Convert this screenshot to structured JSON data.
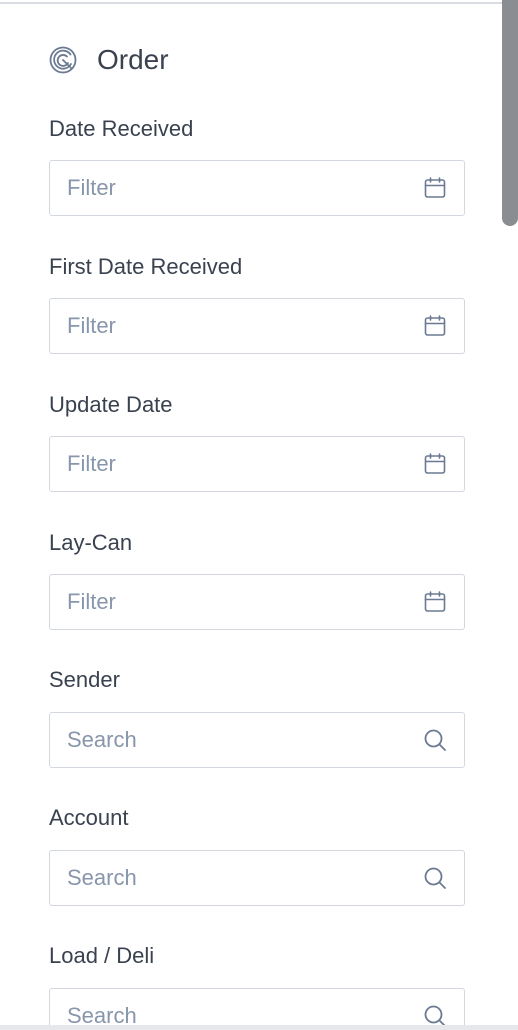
{
  "header": {
    "title": "Order",
    "logo_icon": "circular-logo-icon"
  },
  "fields": [
    {
      "label": "Date Received",
      "placeholder": "Filter",
      "icon": "calendar-icon"
    },
    {
      "label": "First Date Received",
      "placeholder": "Filter",
      "icon": "calendar-icon"
    },
    {
      "label": "Update Date",
      "placeholder": "Filter",
      "icon": "calendar-icon"
    },
    {
      "label": "Lay-Can",
      "placeholder": "Filter",
      "icon": "calendar-icon"
    },
    {
      "label": "Sender",
      "placeholder": "Search",
      "icon": "search-icon"
    },
    {
      "label": "Account",
      "placeholder": "Search",
      "icon": "search-icon"
    },
    {
      "label": "Load / Deli",
      "placeholder": "Search",
      "icon": "search-icon"
    }
  ],
  "colors": {
    "text": "#3a4250",
    "placeholder": "#8896ab",
    "icon": "#6b7a92",
    "border": "#d3d8df",
    "scrollbar": "#8a8d91"
  }
}
